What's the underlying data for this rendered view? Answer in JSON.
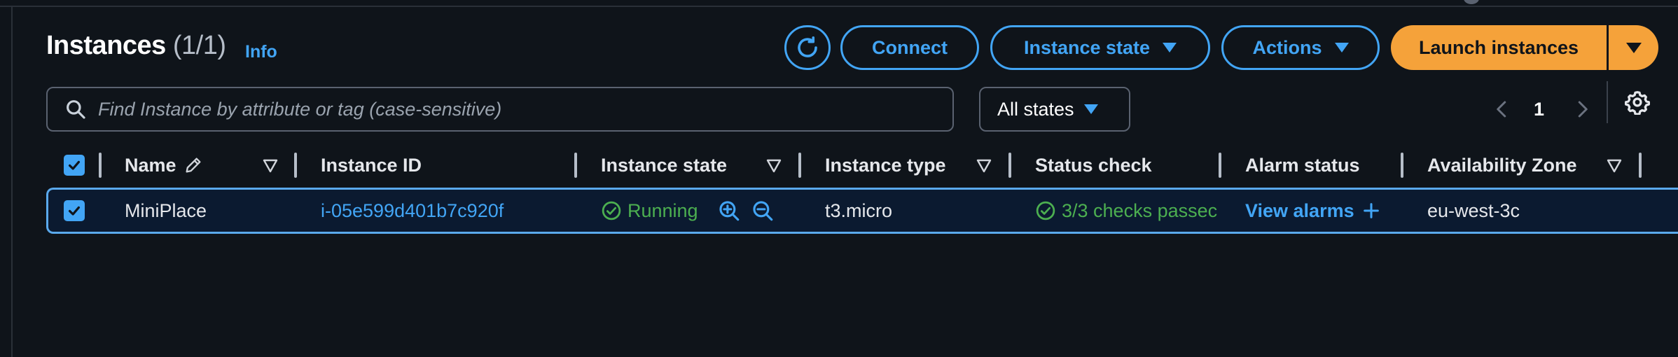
{
  "header": {
    "title": "Instances",
    "count": "(1/1)",
    "info_link": "Info"
  },
  "toolbar": {
    "connect_label": "Connect",
    "instance_state_label": "Instance state",
    "actions_label": "Actions",
    "launch_label": "Launch instances"
  },
  "search": {
    "placeholder": "Find Instance by attribute or tag (case-sensitive)"
  },
  "state_filter": {
    "selected": "All states"
  },
  "pagination": {
    "current_page": "1"
  },
  "columns": [
    {
      "label": "Name"
    },
    {
      "label": "Instance ID"
    },
    {
      "label": "Instance state"
    },
    {
      "label": "Instance type"
    },
    {
      "label": "Status check"
    },
    {
      "label": "Alarm status"
    },
    {
      "label": "Availability Zone"
    }
  ],
  "rows": [
    {
      "name": "MiniPlace",
      "instance_id": "i-05e599d401b7c920f",
      "instance_state": "Running",
      "instance_type": "t3.micro",
      "status_check": "3/3 checks passec",
      "alarm_status": "View alarms",
      "availability_zone": "eu-west-3c"
    }
  ],
  "colors": {
    "background": "#0f141a",
    "accent_blue": "#42a5f5",
    "launch_orange": "#f5a23a",
    "status_green": "#4caf50",
    "selected_row": "#0b1a30"
  },
  "icons": {
    "refresh": "refresh-icon",
    "search": "search-icon",
    "settings": "gear-icon",
    "running": "check-circle-icon",
    "zoom_in": "zoom-in-icon",
    "zoom_out": "zoom-out-icon",
    "edit": "pencil-icon"
  }
}
